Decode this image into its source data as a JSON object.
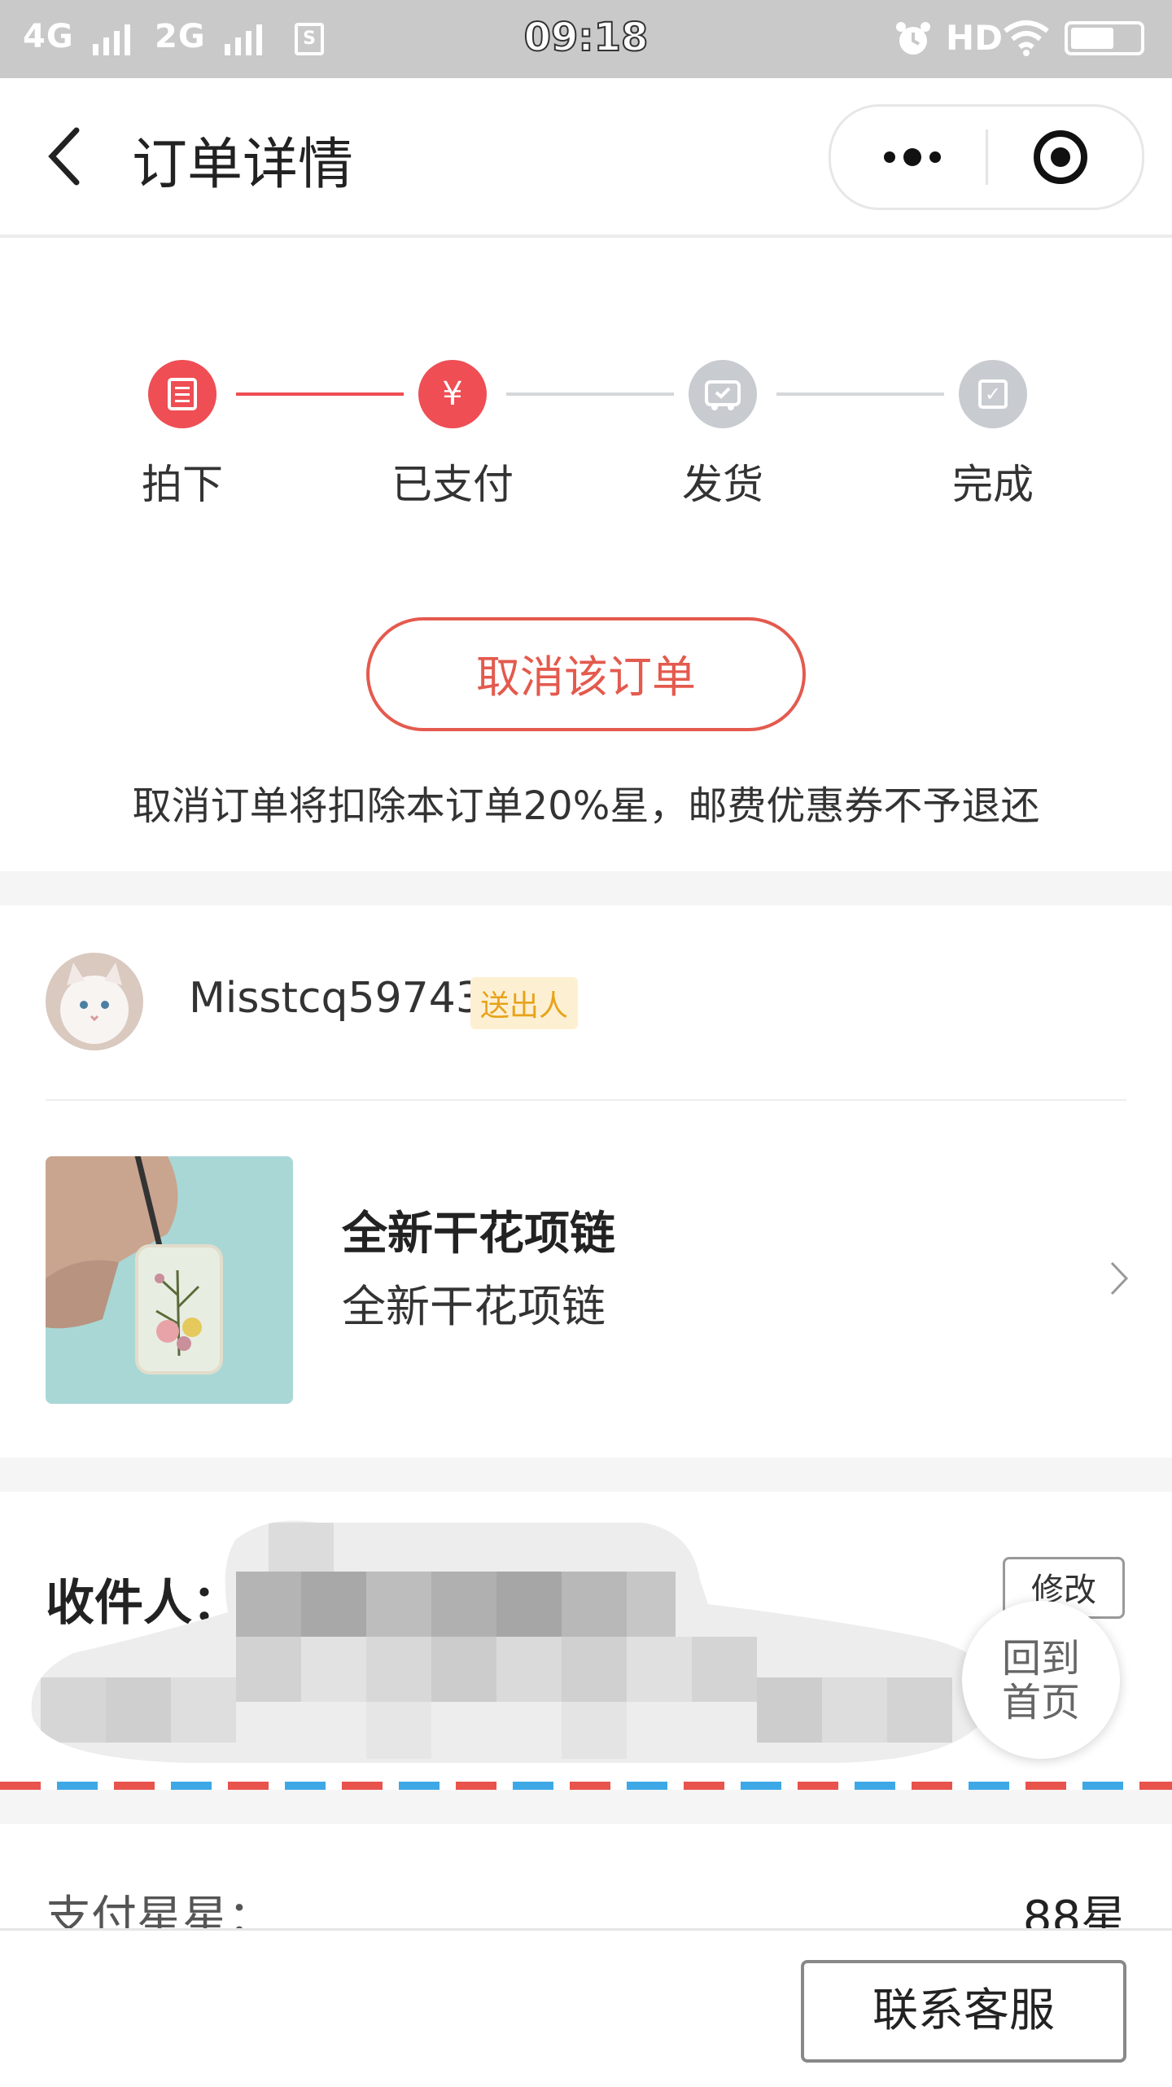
{
  "status_bar": {
    "network1": "4G",
    "network2": "2G",
    "sim_icon": "sim-card-icon",
    "time": "09:18",
    "hd": "HD",
    "icons": [
      "alarm-icon",
      "wifi-icon",
      "battery-icon"
    ]
  },
  "nav": {
    "title": "订单详情",
    "back_icon": "chevron-left-icon",
    "more_icon": "more-dots-icon",
    "target_icon": "target-icon"
  },
  "progress": {
    "steps": [
      {
        "label": "拍下",
        "state": "done",
        "icon": "document-icon",
        "glyph": "≡"
      },
      {
        "label": "已支付",
        "state": "done",
        "icon": "yuan-icon",
        "glyph": "¥"
      },
      {
        "label": "发货",
        "state": "pending",
        "icon": "truck-icon",
        "glyph": ""
      },
      {
        "label": "完成",
        "state": "pending",
        "icon": "check-box-icon",
        "glyph": "✓"
      }
    ],
    "active_color": "#ee4e54",
    "inactive_color": "#c8cbd0"
  },
  "cancel": {
    "button_label": "取消该订单",
    "note": "取消订单将扣除本订单20%星，邮费优惠券不予退还"
  },
  "seller": {
    "name": "Misstcq59743",
    "badge": "送出人"
  },
  "product": {
    "title": "全新干花项链",
    "description": "全新干花项链"
  },
  "recipient": {
    "label": "收件人：",
    "edit_label": "修改"
  },
  "floating": {
    "home_line1": "回到",
    "home_line2": "首页"
  },
  "payment": {
    "label": "支付星星：",
    "value": "88星"
  },
  "bottom": {
    "contact_label": "联系客服"
  }
}
